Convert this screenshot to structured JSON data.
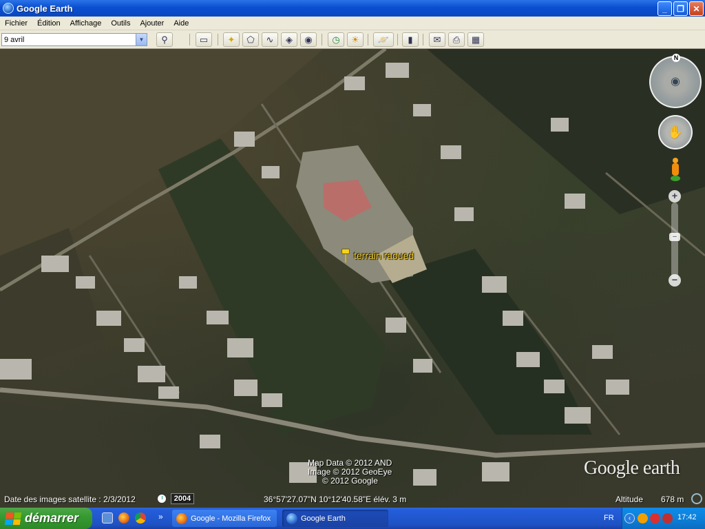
{
  "window": {
    "title": "Google Earth"
  },
  "menu": [
    "Fichier",
    "Édition",
    "Affichage",
    "Outils",
    "Ajouter",
    "Aide"
  ],
  "search": {
    "value": "9 avril"
  },
  "toolbar": {
    "icons": [
      "search-icon",
      "sidebar-toggle-icon",
      "add-placemark-icon",
      "add-polygon-icon",
      "add-path-icon",
      "add-overlay-icon",
      "record-tour-icon",
      "historical-imagery-icon",
      "sunlight-icon",
      "planet-switch-icon",
      "ruler-icon",
      "email-icon",
      "print-icon",
      "view-in-maps-icon"
    ]
  },
  "placemark": {
    "label": "terrain raoued"
  },
  "navigation": {
    "north": "N"
  },
  "credits": {
    "line1": "Map Data © 2012 AND",
    "line2": "Image © 2012 GeoEye",
    "line3": "© 2012 Google"
  },
  "logo": {
    "text": "Google earth"
  },
  "status": {
    "imagery_date": "Date des images satellite : 2/3/2012",
    "year": "2004",
    "coordinates": "36°57'27.07\"N  10°12'40.58\"E  élév.    3 m",
    "altitude_label": "Altitude",
    "altitude_value": "678 m"
  },
  "taskbar": {
    "start": "démarrer",
    "tasks": [
      {
        "label": "Google - Mozilla Firefox"
      },
      {
        "label": "Google Earth"
      }
    ],
    "language": "FR",
    "clock": "17:42"
  },
  "colors": {
    "titlebar": "#0a4fd0",
    "taskbar": "#245edb",
    "start": "#379a31",
    "placemark": "#f7d233"
  }
}
